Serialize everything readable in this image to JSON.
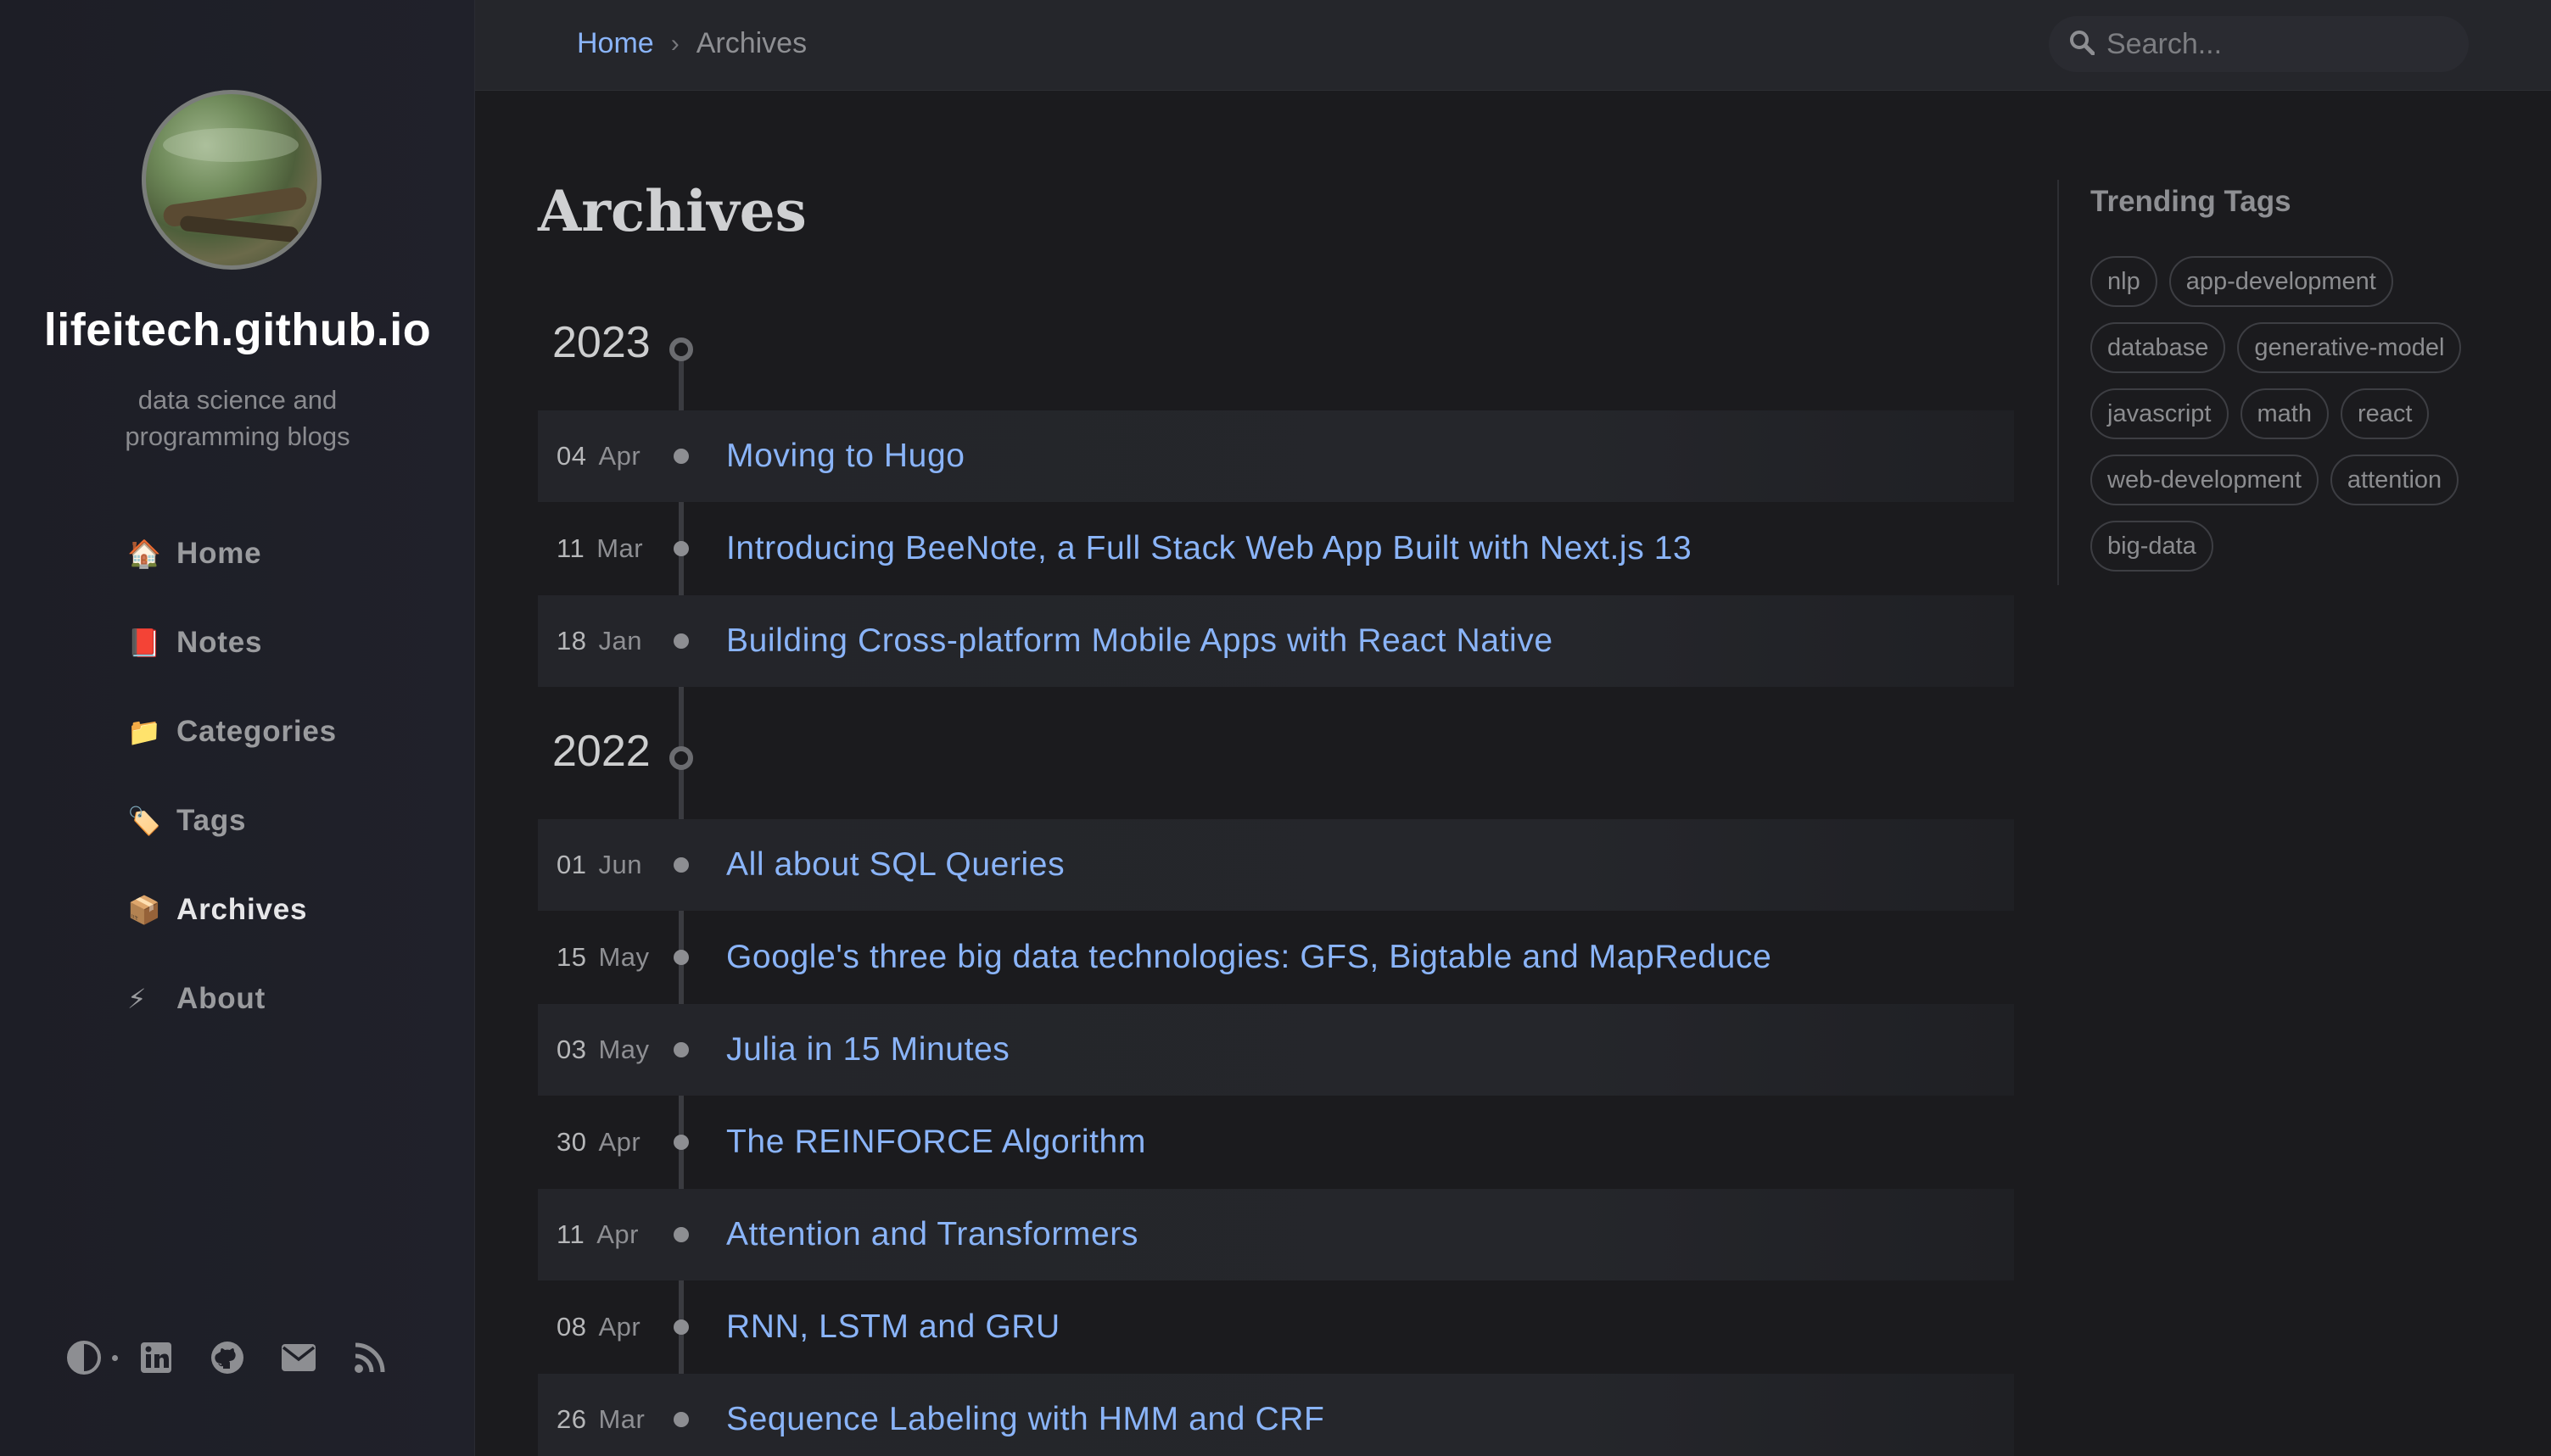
{
  "sidebar": {
    "site_title": "lifeitech.github.io",
    "subtitle": "data science and programming blogs",
    "nav": [
      {
        "icon": "🏠",
        "label": "Home"
      },
      {
        "icon": "📕",
        "label": "Notes"
      },
      {
        "icon": "📁",
        "label": "Categories"
      },
      {
        "icon": "🏷️",
        "label": "Tags"
      },
      {
        "icon": "📦",
        "label": "Archives"
      },
      {
        "icon": "⚡",
        "label": "About"
      }
    ],
    "active_nav": "Archives",
    "bottom_icons": [
      "theme-toggle-icon",
      "linkedin-icon",
      "github-icon",
      "email-icon",
      "rss-icon"
    ]
  },
  "topbar": {
    "breadcrumb": {
      "home": "Home",
      "separator": "›",
      "current": "Archives"
    },
    "search_placeholder": "Search..."
  },
  "main": {
    "title": "Archives",
    "years": [
      {
        "year": "2023",
        "posts": [
          {
            "day": "04",
            "month": "Apr",
            "title": "Moving to Hugo"
          },
          {
            "day": "11",
            "month": "Mar",
            "title": "Introducing BeeNote, a Full Stack Web App Built with Next.js 13"
          },
          {
            "day": "18",
            "month": "Jan",
            "title": "Building Cross-platform Mobile Apps with React Native"
          }
        ]
      },
      {
        "year": "2022",
        "posts": [
          {
            "day": "01",
            "month": "Jun",
            "title": "All about SQL Queries"
          },
          {
            "day": "15",
            "month": "May",
            "title": "Google's three big data technologies: GFS, Bigtable and MapReduce"
          },
          {
            "day": "03",
            "month": "May",
            "title": "Julia in 15 Minutes"
          },
          {
            "day": "30",
            "month": "Apr",
            "title": "The REINFORCE Algorithm"
          },
          {
            "day": "11",
            "month": "Apr",
            "title": "Attention and Transformers"
          },
          {
            "day": "08",
            "month": "Apr",
            "title": "RNN, LSTM and GRU"
          },
          {
            "day": "26",
            "month": "Mar",
            "title": "Sequence Labeling with HMM and CRF"
          }
        ]
      }
    ]
  },
  "trending": {
    "title": "Trending Tags",
    "tags": [
      "nlp",
      "app-development",
      "database",
      "generative-model",
      "javascript",
      "math",
      "react",
      "web-development",
      "attention",
      "big-data"
    ]
  },
  "colors": {
    "link": "#8ab4f8",
    "background": "#1b1b1e",
    "sidebar": "#1e1f27"
  }
}
